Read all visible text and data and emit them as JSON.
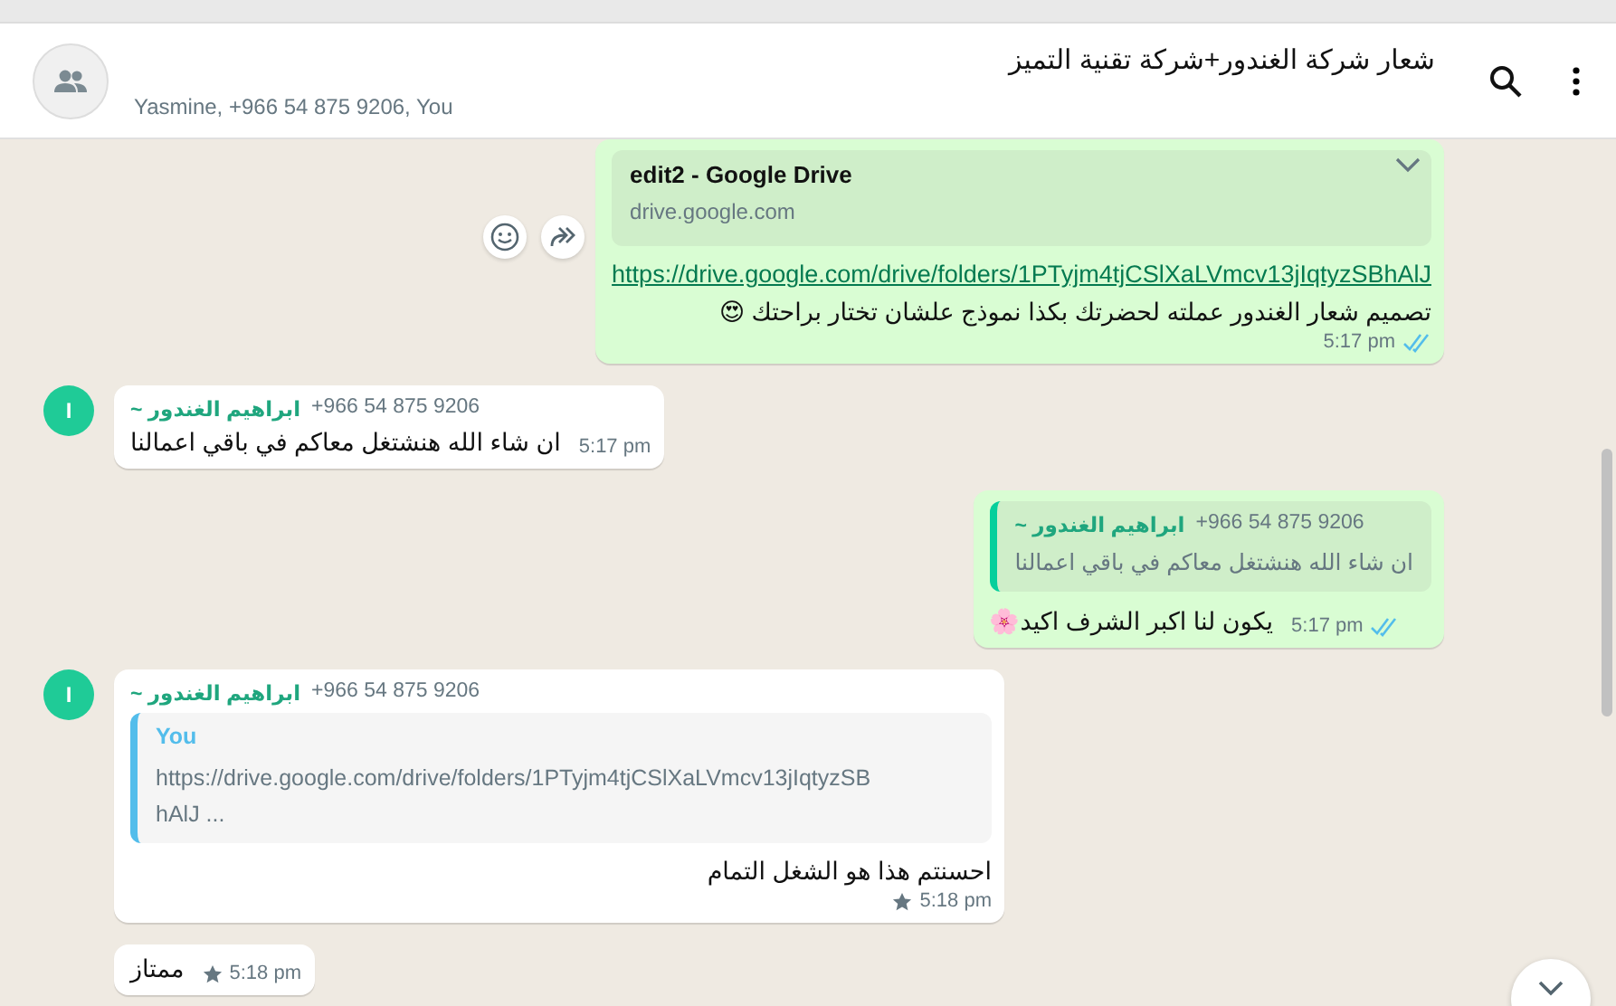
{
  "header": {
    "title": "شعار شركة الغندور+شركة تقنية التميز",
    "participants": "Yasmine, +966 54 875 9206, You"
  },
  "messages": [
    {
      "kind": "out",
      "link_preview": {
        "title": "edit2 - Google Drive",
        "domain": "drive.google.com"
      },
      "link": "https://drive.google.com/drive/folders/1PTyjm4tjCSlXaLVmcv13jIqtyzSBhAlJ",
      "text": "تصميم شعار الغندور عملته لحضرتك بكذا نموذج علشان تختار براحتك 😍",
      "time": "5:17 pm",
      "read": true
    },
    {
      "kind": "in",
      "avatar": "I",
      "sender_name": "~ ابراهيم الغندور",
      "sender_phone": "+966 54 875 9206",
      "text": "ان شاء الله هنشتغل معاكم في باقي اعمالنا",
      "time": "5:17 pm"
    },
    {
      "kind": "out",
      "quote": {
        "author": "~ ابراهيم الغندور",
        "phone": "+966 54 875 9206",
        "text": "ان شاء الله هنشتغل معاكم في باقي اعمالنا"
      },
      "text": "يكون لنا اكبر الشرف اكيد🌸",
      "time": "5:17 pm",
      "read": true
    },
    {
      "kind": "in",
      "avatar": "I",
      "sender_name": "~ ابراهيم الغندور",
      "sender_phone": "+966 54 875 9206",
      "quote": {
        "author": "You",
        "text": "https://drive.google.com/drive/folders/1PTyjm4tjCSlXaLVmcv13jIqtyzSBhAlJ  ..."
      },
      "text": "احسنتم هذا هو الشغل التمام",
      "time": "5:18 pm",
      "starred": true
    },
    {
      "kind": "in",
      "text": "ممتاز",
      "time": "5:18 pm",
      "starred": true
    }
  ]
}
